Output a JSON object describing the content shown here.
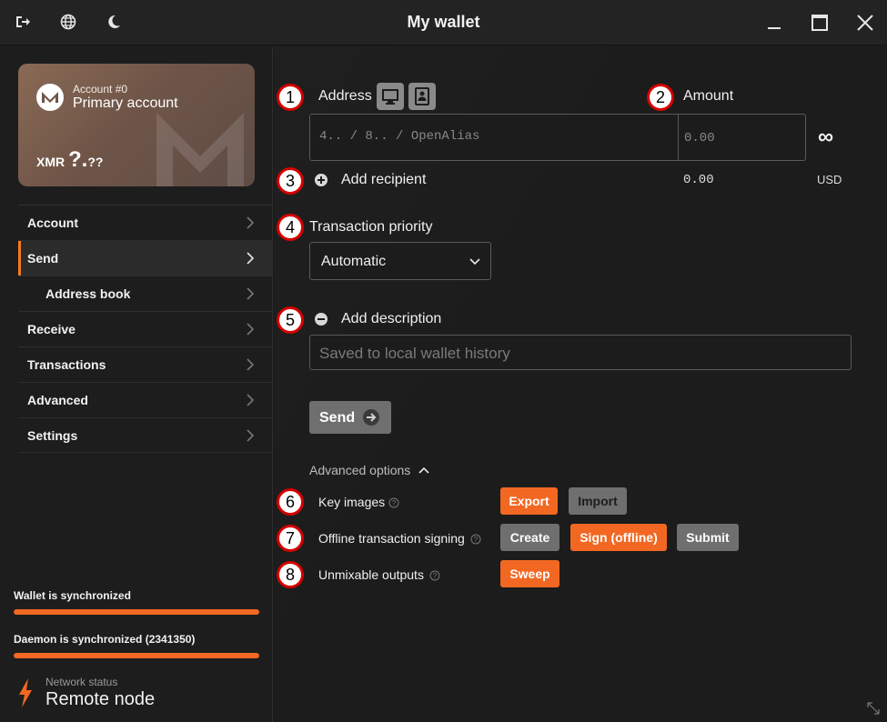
{
  "window": {
    "title": "My wallet",
    "icons": [
      "logout-icon",
      "globe-icon",
      "moon-icon",
      "minimize-icon",
      "maximize-icon",
      "close-icon"
    ]
  },
  "account_card": {
    "account_number": "Account #0",
    "account_name": "Primary account",
    "currency": "XMR",
    "balance_main": "?.",
    "balance_small": "??"
  },
  "nav": {
    "items": [
      {
        "label": "Account"
      },
      {
        "label": "Send"
      },
      {
        "label": "Address book"
      },
      {
        "label": "Receive"
      },
      {
        "label": "Transactions"
      },
      {
        "label": "Advanced"
      },
      {
        "label": "Settings"
      }
    ]
  },
  "status": {
    "wallet_sync_label": "Wallet is synchronized",
    "wallet_sync_progress": 1.0,
    "daemon_sync_label": "Daemon is synchronized (2341350)",
    "daemon_sync_progress": 1.0,
    "network_status_label": "Network status",
    "network_status_value": "Remote node"
  },
  "send": {
    "markers": [
      "1",
      "2",
      "3",
      "4",
      "5",
      "6",
      "7",
      "8"
    ],
    "address_label": "Address",
    "amount_label": "Amount",
    "address_placeholder": "4.. / 8.. / OpenAlias",
    "amount_placeholder": "0.00",
    "max_symbol": "∞",
    "add_recipient_label": "Add recipient",
    "fiat_value": "0.00",
    "fiat_currency": "USD",
    "priority_label": "Transaction priority",
    "priority_value": "Automatic",
    "add_description_label": "Add description",
    "description_placeholder": "Saved to local wallet history",
    "send_button": "Send"
  },
  "advanced_options": {
    "toggle_label": "Advanced options",
    "key_images_label": "Key images",
    "key_images_export": "Export",
    "key_images_import": "Import",
    "offline_label": "Offline transaction signing",
    "offline_create": "Create",
    "offline_sign": "Sign (offline)",
    "offline_submit": "Submit",
    "unmixable_label": "Unmixable outputs",
    "unmixable_sweep": "Sweep"
  },
  "colors": {
    "accent": "#f26822",
    "marker_border": "#d40000",
    "background": "#1c1c1c"
  }
}
